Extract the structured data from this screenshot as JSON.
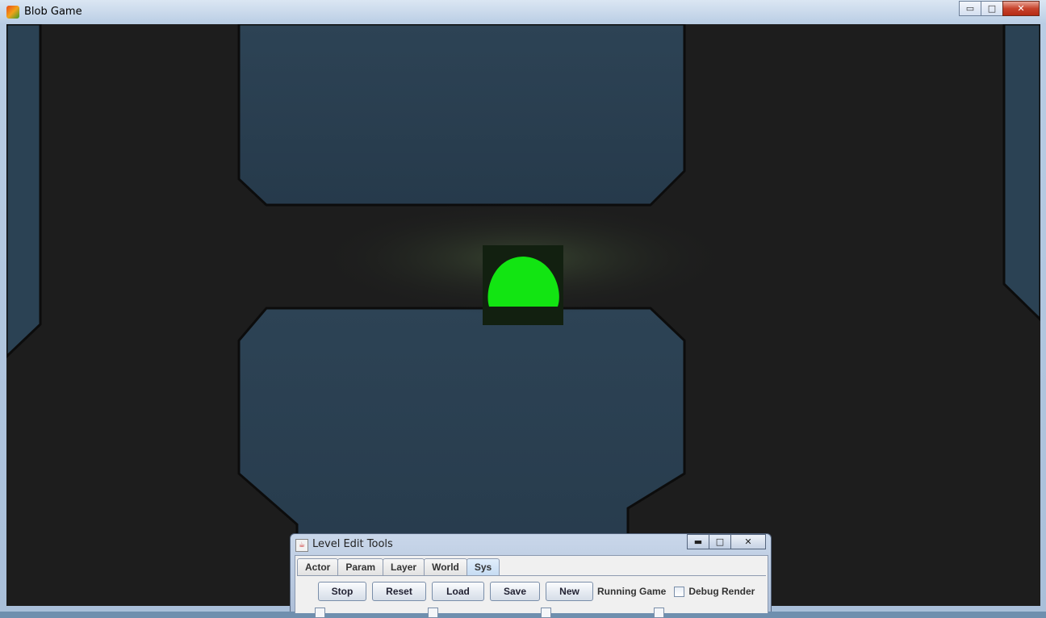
{
  "window": {
    "title": "Blob Game",
    "controls": {
      "minimize": "▭",
      "maximize": "□",
      "close": "✕"
    }
  },
  "game": {
    "player": "green-blob"
  },
  "tools": {
    "title": "Level Edit Tools",
    "controls": {
      "minimize": "▬",
      "maximize": "□",
      "close": "✕"
    },
    "tabs": [
      "Actor",
      "Param",
      "Layer",
      "World",
      "Sys"
    ],
    "active_tab": "Sys",
    "buttons": {
      "stop": "Stop",
      "reset": "Reset",
      "load": "Load",
      "save": "Save",
      "new": "New"
    },
    "status": "Running Game",
    "debug_render": {
      "label": "Debug Render",
      "checked": false
    }
  }
}
